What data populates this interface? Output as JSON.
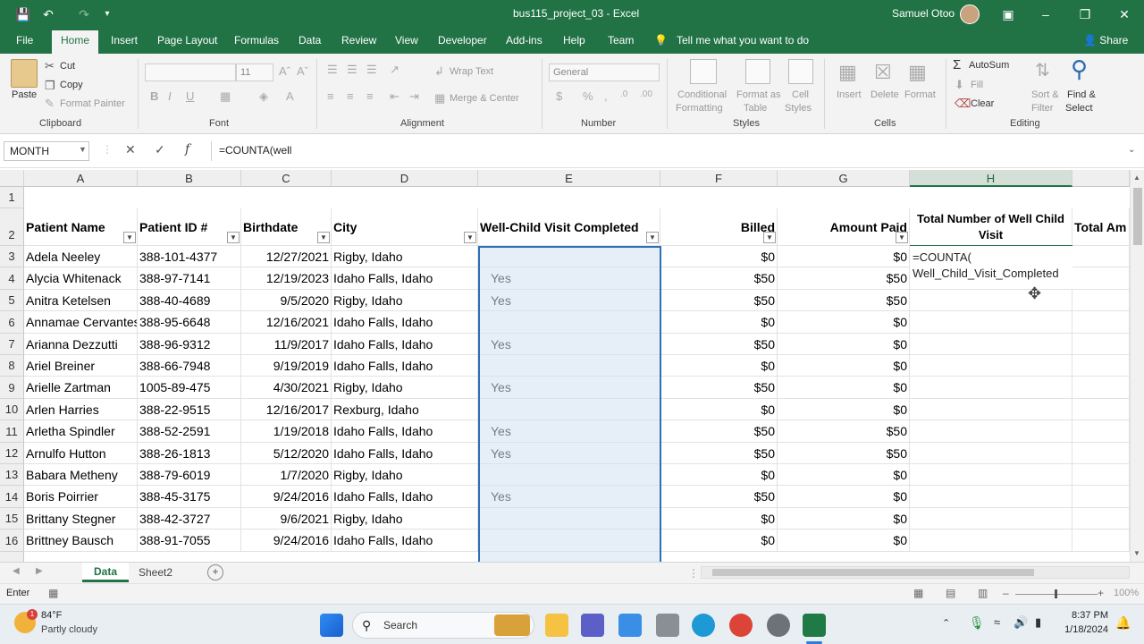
{
  "window": {
    "title": "bus115_project_03  -  Excel",
    "user": "Samuel Otoo"
  },
  "ribbon_tabs": [
    "File",
    "Home",
    "Insert",
    "Page Layout",
    "Formulas",
    "Data",
    "Review",
    "View",
    "Developer",
    "Add-ins",
    "Help",
    "Team"
  ],
  "tell_me": "Tell me what you want to do",
  "share": "Share",
  "ribbon": {
    "clipboard": {
      "paste": "Paste",
      "cut": "Cut",
      "copy": "Copy",
      "format_painter": "Format Painter",
      "label": "Clipboard"
    },
    "font": {
      "size": "11",
      "label": "Font"
    },
    "alignment": {
      "wrap": "Wrap Text",
      "merge": "Merge & Center",
      "label": "Alignment"
    },
    "number": {
      "format": "General",
      "label": "Number"
    },
    "styles": {
      "cond": "Conditional",
      "cond2": "Formatting",
      "fmt_table": "Format as",
      "fmt_table2": "Table",
      "cell_styles": "Cell",
      "cell_styles2": "Styles",
      "label": "Styles"
    },
    "cells": {
      "insert": "Insert",
      "delete": "Delete",
      "format": "Format",
      "label": "Cells"
    },
    "editing": {
      "autosum": "AutoSum",
      "fill": "Fill",
      "clear": "Clear",
      "sort": "Sort &",
      "sort2": "Filter",
      "find": "Find &",
      "find2": "Select",
      "label": "Editing"
    }
  },
  "formula_bar": {
    "name_box": "MONTH",
    "formula": "=COUNTA(well"
  },
  "columns": [
    "A",
    "B",
    "C",
    "D",
    "E",
    "F",
    "G",
    "H"
  ],
  "headers": {
    "patient_name": "Patient Name",
    "patient_id": "Patient ID #",
    "birthdate": "Birthdate",
    "city": "City",
    "wcv": "Well-Child Visit Completed",
    "billed": "Billed",
    "amount_paid": "Amount Paid",
    "total_wc": "Total Number of Well Child Visit",
    "total_am": "Total Am"
  },
  "edit_cell": {
    "line1": "=COUNTA(",
    "line2": "Well_Child_Visit_Completed"
  },
  "rows": [
    {
      "n": "3",
      "name": "Adela Neeley",
      "id": "388-101-4377",
      "bd": "12/27/2021",
      "city": "Rigby, Idaho",
      "wcv": "",
      "billed": "$0",
      "paid": "$0"
    },
    {
      "n": "4",
      "name": "Alycia Whitenack",
      "id": "388-97-7141",
      "bd": "12/19/2023",
      "city": "Idaho Falls, Idaho",
      "wcv": "Yes",
      "billed": "$50",
      "paid": "$50"
    },
    {
      "n": "5",
      "name": "Anitra Ketelsen",
      "id": "388-40-4689",
      "bd": "9/5/2020",
      "city": "Rigby, Idaho",
      "wcv": "Yes",
      "billed": "$50",
      "paid": "$50"
    },
    {
      "n": "6",
      "name": "Annamae Cervantes",
      "id": "388-95-6648",
      "bd": "12/16/2021",
      "city": "Idaho Falls, Idaho",
      "wcv": "",
      "billed": "$0",
      "paid": "$0"
    },
    {
      "n": "7",
      "name": "Arianna Dezzutti",
      "id": "388-96-9312",
      "bd": "11/9/2017",
      "city": "Idaho Falls, Idaho",
      "wcv": "Yes",
      "billed": "$50",
      "paid": "$0"
    },
    {
      "n": "8",
      "name": "Ariel Breiner",
      "id": "388-66-7948",
      "bd": "9/19/2019",
      "city": "Idaho Falls, Idaho",
      "wcv": "",
      "billed": "$0",
      "paid": "$0"
    },
    {
      "n": "9",
      "name": "Arielle Zartman",
      "id": "1005-89-475",
      "bd": "4/30/2021",
      "city": "Rigby, Idaho",
      "wcv": "Yes",
      "billed": "$50",
      "paid": "$0"
    },
    {
      "n": "10",
      "name": "Arlen Harries",
      "id": "388-22-9515",
      "bd": "12/16/2017",
      "city": "Rexburg, Idaho",
      "wcv": "",
      "billed": "$0",
      "paid": "$0"
    },
    {
      "n": "11",
      "name": "Arletha Spindler",
      "id": "388-52-2591",
      "bd": "1/19/2018",
      "city": "Idaho Falls, Idaho",
      "wcv": "Yes",
      "billed": "$50",
      "paid": "$50"
    },
    {
      "n": "12",
      "name": "Arnulfo Hutton",
      "id": "388-26-1813",
      "bd": "5/12/2020",
      "city": "Idaho Falls, Idaho",
      "wcv": "Yes",
      "billed": "$50",
      "paid": "$50"
    },
    {
      "n": "13",
      "name": "Babara Metheny",
      "id": "388-79-6019",
      "bd": "1/7/2020",
      "city": "Rigby, Idaho",
      "wcv": "",
      "billed": "$0",
      "paid": "$0"
    },
    {
      "n": "14",
      "name": "Boris Poirrier",
      "id": "388-45-3175",
      "bd": "9/24/2016",
      "city": "Idaho Falls, Idaho",
      "wcv": "Yes",
      "billed": "$50",
      "paid": "$0"
    },
    {
      "n": "15",
      "name": "Brittany Stegner",
      "id": "388-42-3727",
      "bd": "9/6/2021",
      "city": "Rigby, Idaho",
      "wcv": "",
      "billed": "$0",
      "paid": "$0"
    },
    {
      "n": "16",
      "name": "Brittney Bausch",
      "id": "388-91-7055",
      "bd": "9/24/2016",
      "city": "Idaho Falls, Idaho",
      "wcv": "",
      "billed": "$0",
      "paid": "$0"
    }
  ],
  "sheets": [
    "Data",
    "Sheet2"
  ],
  "status": {
    "mode": "Enter",
    "zoom": "100%"
  },
  "taskbar": {
    "weather_temp": "84°F",
    "weather_desc": "Partly cloudy",
    "search": "Search",
    "time": "8:37 PM",
    "date": "1/18/2024"
  }
}
